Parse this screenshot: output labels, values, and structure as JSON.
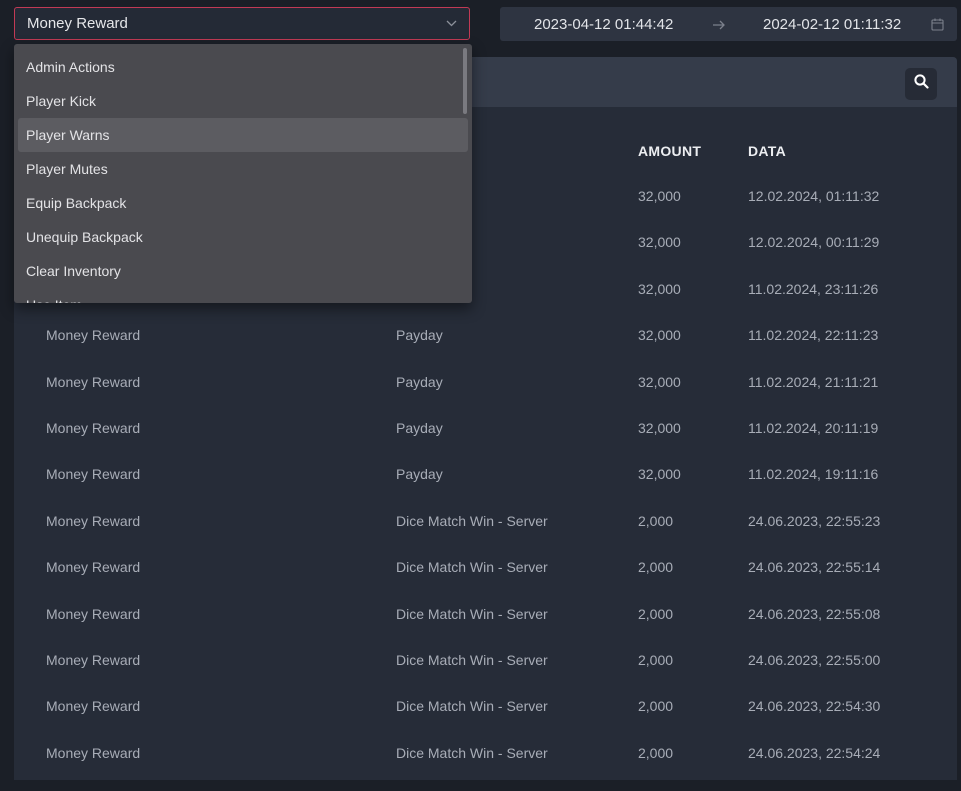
{
  "filter": {
    "selected": "Money Reward",
    "options": [
      "Admin Actions",
      "Player Kick",
      "Player Warns",
      "Player Mutes",
      "Equip Backpack",
      "Unequip Backpack",
      "Clear Inventory",
      "Use Item"
    ],
    "highlighted_index": 2
  },
  "date_range": {
    "start": "2023-04-12 01:44:42",
    "end": "2024-02-12 01:11:32"
  },
  "icons": {
    "chevron": "chevron-down-icon",
    "arrow": "arrow-right-icon",
    "calendar": "calendar-icon",
    "search": "search-icon"
  },
  "colors": {
    "accent_border": "#c23a55",
    "background": "#1b1f27",
    "panel": "#262c38"
  },
  "table": {
    "headers": {
      "amount": "AMOUNT",
      "date": "DATA"
    },
    "rows": [
      {
        "type": "",
        "reason": "",
        "amount": "32,000",
        "date": "12.02.2024, 01:11:32"
      },
      {
        "type": "",
        "reason": "",
        "amount": "32,000",
        "date": "12.02.2024, 00:11:29"
      },
      {
        "type": "",
        "reason": "",
        "amount": "32,000",
        "date": "11.02.2024, 23:11:26"
      },
      {
        "type": "Money Reward",
        "reason": "Payday",
        "amount": "32,000",
        "date": "11.02.2024, 22:11:23"
      },
      {
        "type": "Money Reward",
        "reason": "Payday",
        "amount": "32,000",
        "date": "11.02.2024, 21:11:21"
      },
      {
        "type": "Money Reward",
        "reason": "Payday",
        "amount": "32,000",
        "date": "11.02.2024, 20:11:19"
      },
      {
        "type": "Money Reward",
        "reason": "Payday",
        "amount": "32,000",
        "date": "11.02.2024, 19:11:16"
      },
      {
        "type": "Money Reward",
        "reason": "Dice Match Win - Server",
        "amount": "2,000",
        "date": "24.06.2023, 22:55:23"
      },
      {
        "type": "Money Reward",
        "reason": "Dice Match Win - Server",
        "amount": "2,000",
        "date": "24.06.2023, 22:55:14"
      },
      {
        "type": "Money Reward",
        "reason": "Dice Match Win - Server",
        "amount": "2,000",
        "date": "24.06.2023, 22:55:08"
      },
      {
        "type": "Money Reward",
        "reason": "Dice Match Win - Server",
        "amount": "2,000",
        "date": "24.06.2023, 22:55:00"
      },
      {
        "type": "Money Reward",
        "reason": "Dice Match Win - Server",
        "amount": "2,000",
        "date": "24.06.2023, 22:54:30"
      },
      {
        "type": "Money Reward",
        "reason": "Dice Match Win - Server",
        "amount": "2,000",
        "date": "24.06.2023, 22:54:24"
      }
    ]
  }
}
